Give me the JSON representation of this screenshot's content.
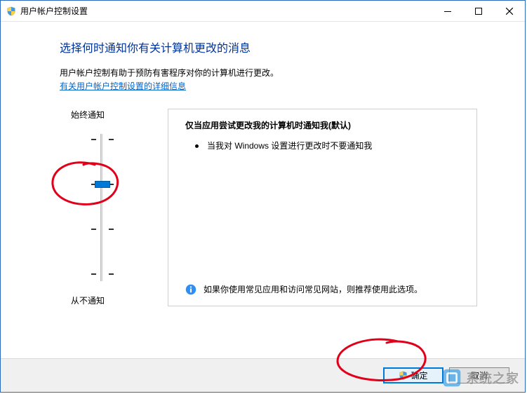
{
  "titlebar": {
    "title": "用户帐户控制设置"
  },
  "page": {
    "heading": "选择何时通知你有关计算机更改的消息",
    "desc": "用户帐户控制有助于预防有害程序对你的计算机进行更改。",
    "link": "有关用户帐户控制设置的详细信息"
  },
  "slider": {
    "top_label": "始终通知",
    "bottom_label": "从不通知",
    "position_index": 1,
    "positions": 4
  },
  "panel": {
    "title": "仅当应用尝试更改我的计算机时通知我(默认)",
    "bullet": "当我对 Windows 设置进行更改时不要通知我",
    "info": "如果你使用常见应用和访问常见网站，则推荐使用此选项。"
  },
  "footer": {
    "ok": "确定",
    "cancel": "取消"
  },
  "watermark": {
    "text": "系统之家"
  },
  "annotations": {
    "circle_slider": true,
    "circle_ok": true
  },
  "colors": {
    "heading": "#003399",
    "link": "#0066cc",
    "accent": "#0078d7",
    "annotation": "#e1001a"
  }
}
